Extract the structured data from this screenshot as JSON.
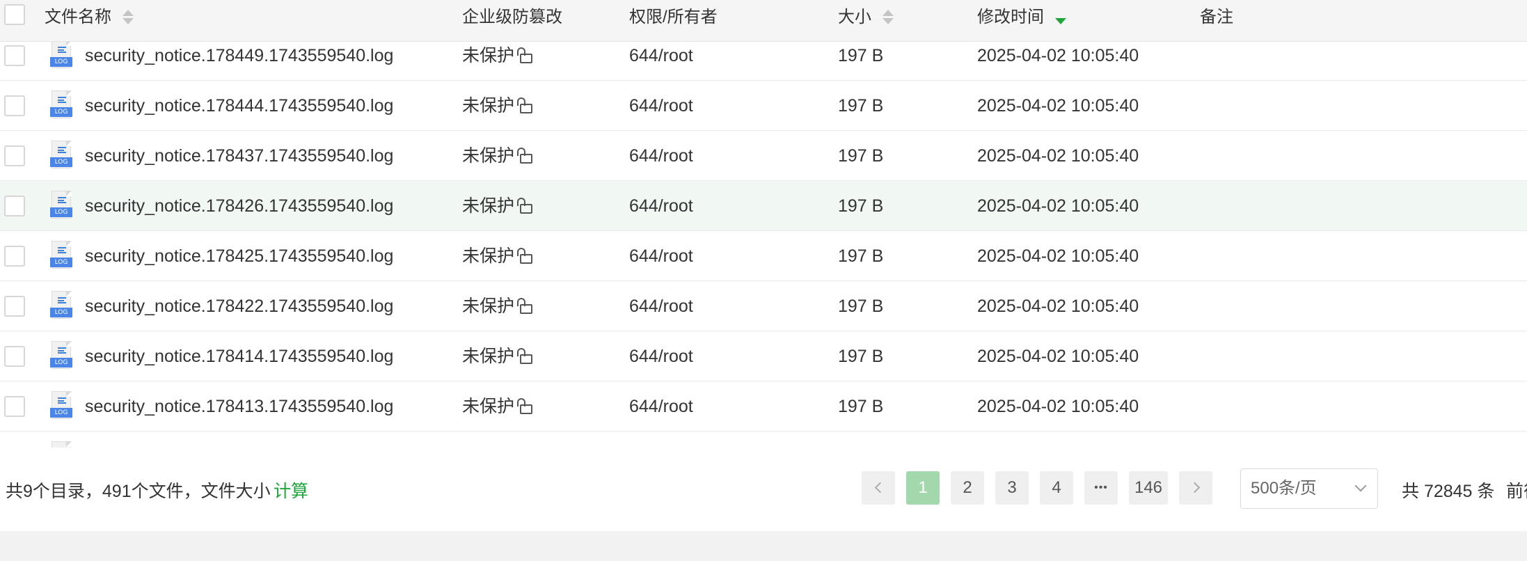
{
  "table": {
    "headers": {
      "name": "文件名称",
      "protect": "企业级防篡改",
      "perm": "权限/所有者",
      "size": "大小",
      "mtime": "修改时间",
      "remark": "备注"
    },
    "rows": [
      {
        "name": "security_notice.178449.1743559540.log",
        "protect": "未保护",
        "perm": "644/root",
        "size": "197 B",
        "mtime": "2025-04-02 10:05:40",
        "remark": ""
      },
      {
        "name": "security_notice.178444.1743559540.log",
        "protect": "未保护",
        "perm": "644/root",
        "size": "197 B",
        "mtime": "2025-04-02 10:05:40",
        "remark": ""
      },
      {
        "name": "security_notice.178437.1743559540.log",
        "protect": "未保护",
        "perm": "644/root",
        "size": "197 B",
        "mtime": "2025-04-02 10:05:40",
        "remark": ""
      },
      {
        "name": "security_notice.178426.1743559540.log",
        "protect": "未保护",
        "perm": "644/root",
        "size": "197 B",
        "mtime": "2025-04-02 10:05:40",
        "remark": ""
      },
      {
        "name": "security_notice.178425.1743559540.log",
        "protect": "未保护",
        "perm": "644/root",
        "size": "197 B",
        "mtime": "2025-04-02 10:05:40",
        "remark": ""
      },
      {
        "name": "security_notice.178422.1743559540.log",
        "protect": "未保护",
        "perm": "644/root",
        "size": "197 B",
        "mtime": "2025-04-02 10:05:40",
        "remark": ""
      },
      {
        "name": "security_notice.178414.1743559540.log",
        "protect": "未保护",
        "perm": "644/root",
        "size": "197 B",
        "mtime": "2025-04-02 10:05:40",
        "remark": ""
      },
      {
        "name": "security_notice.178413.1743559540.log",
        "protect": "未保护",
        "perm": "644/root",
        "size": "197 B",
        "mtime": "2025-04-02 10:05:40",
        "remark": ""
      }
    ],
    "file_icon_tag": "LOG",
    "highlight_row_color": "#f1f8f4"
  },
  "footer": {
    "summary": "共9个目录，491个文件，文件大小",
    "calc_link": "计算",
    "pagination": {
      "pages": [
        "1",
        "2",
        "3",
        "4"
      ],
      "ellipsis": "•••",
      "last_page": "146",
      "current": "1"
    },
    "page_size": "500条/页",
    "total": "共 72845 条",
    "goto_partial": "前往"
  },
  "colors": {
    "accent": "#20a53a",
    "active_page": "#a3d8ad"
  }
}
